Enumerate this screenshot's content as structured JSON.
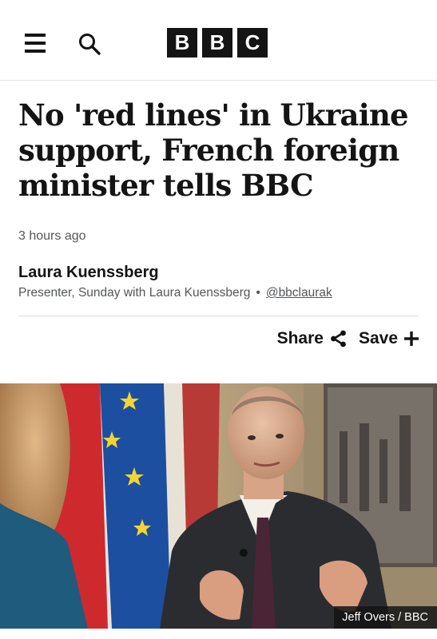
{
  "header": {
    "logo_letters": [
      "B",
      "B",
      "C"
    ],
    "menu_icon": "hamburger-menu-icon",
    "search_icon": "search-icon"
  },
  "article": {
    "headline": "No 'red lines' in Ukraine support, French foreign minister tells BBC",
    "timestamp": "3 hours ago",
    "author": {
      "name": "Laura Kuenssberg",
      "role": "Presenter, Sunday with Laura Kuenssberg",
      "separator": "•",
      "handle": "@bbclaurak"
    },
    "actions": {
      "share_label": "Share",
      "share_icon": "share-icon",
      "save_label": "Save",
      "save_icon": "plus-icon"
    },
    "image": {
      "credit": "Jeff Overs / BBC"
    }
  },
  "colors": {
    "text": "#141414",
    "meta": "#545658",
    "logo_bg": "#141414"
  }
}
